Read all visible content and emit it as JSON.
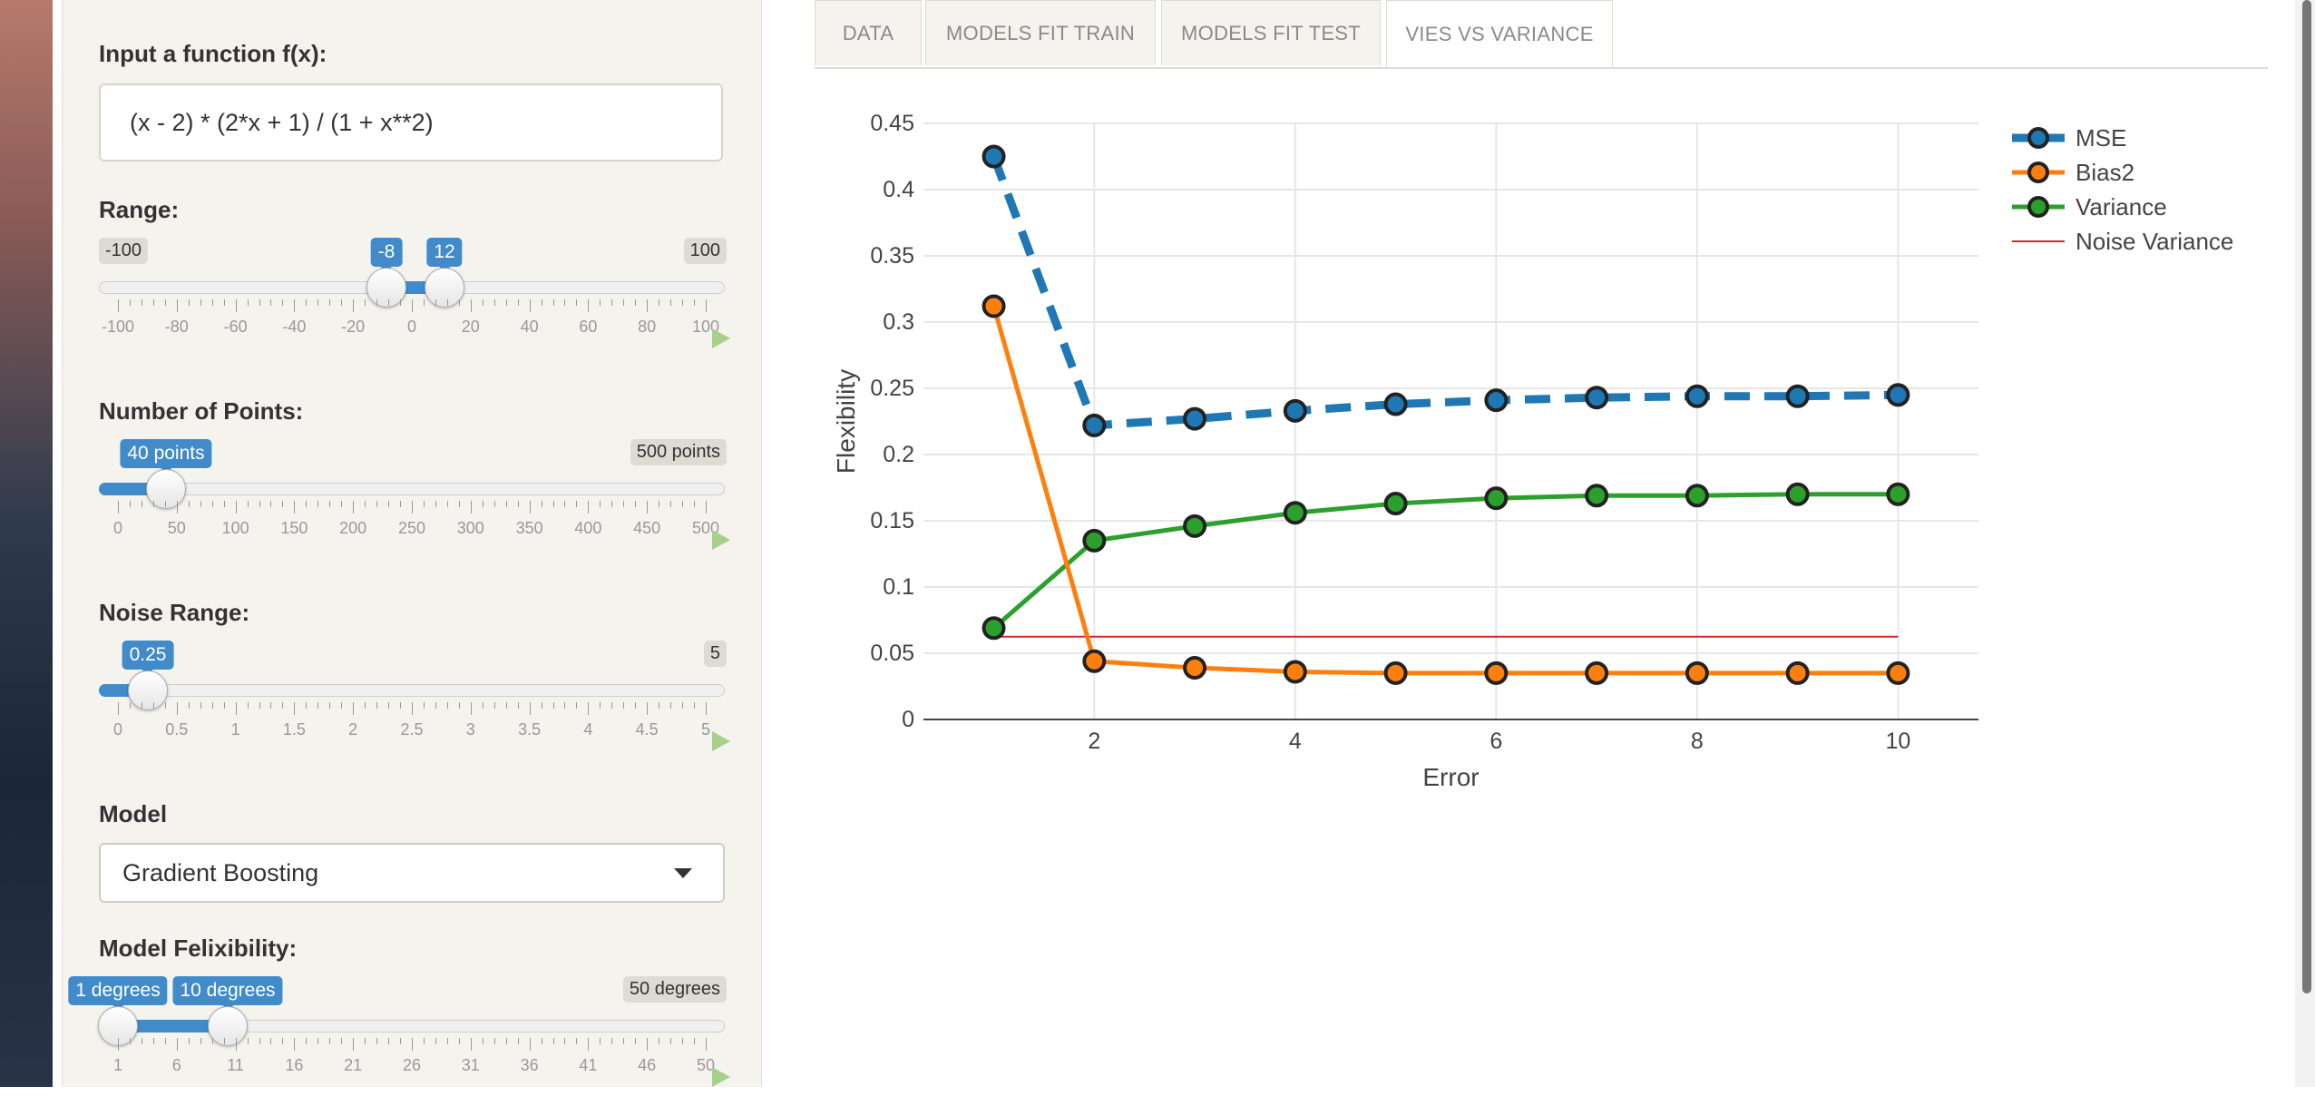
{
  "sidebar": {
    "function": {
      "label": "Input a function f(x):",
      "value": "(x - 2) * (2*x + 1) / (1 + x**2)"
    },
    "range": {
      "label": "Range:",
      "min": "-100",
      "max": "100",
      "low": "-8",
      "high": "12",
      "ticks": [
        "-100",
        "-80",
        "-60",
        "-40",
        "-20",
        "0",
        "20",
        "40",
        "60",
        "80",
        "100"
      ]
    },
    "points": {
      "label": "Number of Points:",
      "value": "40 points",
      "max": "500 points",
      "ticks": [
        "0",
        "50",
        "100",
        "150",
        "200",
        "250",
        "300",
        "350",
        "400",
        "450",
        "500"
      ]
    },
    "noise": {
      "label": "Noise Range:",
      "value": "0.25",
      "max": "5",
      "ticks": [
        "0",
        "0.5",
        "1",
        "1.5",
        "2",
        "2.5",
        "3",
        "3.5",
        "4",
        "4.5",
        "5"
      ]
    },
    "model": {
      "label": "Model",
      "selected": "Gradient Boosting"
    },
    "flex": {
      "label": "Model Felixibility:",
      "low": "1 degrees",
      "high": "10 degrees",
      "max": "50 degrees",
      "ticks": [
        "1",
        "6",
        "11",
        "16",
        "21",
        "26",
        "31",
        "36",
        "41",
        "46",
        "50"
      ]
    },
    "colors": {
      "accent": "#428bca"
    }
  },
  "tabs": [
    {
      "label": "DATA"
    },
    {
      "label": "MODELS FIT TRAIN"
    },
    {
      "label": "MODELS FIT TEST"
    },
    {
      "label": "VIES VS VARIANCE"
    }
  ],
  "chart_data": {
    "type": "line",
    "xlabel": "Error",
    "ylabel": "Flexibility",
    "xlim": [
      0.3,
      10.8
    ],
    "ylim": [
      0,
      0.45
    ],
    "xticks": [
      2,
      4,
      6,
      8,
      10
    ],
    "yticks": [
      0,
      0.05,
      0.1,
      0.15,
      0.2,
      0.25,
      0.3,
      0.35,
      0.4,
      0.45
    ],
    "ytick_labels": [
      "0",
      "0.05",
      "0.1",
      "0.15",
      "0.2",
      "0.25",
      "0.3",
      "0.35",
      "0.4",
      "0.45"
    ],
    "grid": true,
    "legend_position": "top-right",
    "x": [
      1,
      2,
      3,
      4,
      5,
      6,
      7,
      8,
      9,
      10
    ],
    "series": [
      {
        "name": "MSE",
        "color": "#1f77b4",
        "dash": true,
        "values": [
          0.425,
          0.222,
          0.227,
          0.233,
          0.238,
          0.241,
          0.243,
          0.244,
          0.244,
          0.245
        ]
      },
      {
        "name": "Bias2",
        "color": "#ff7f0e",
        "dash": false,
        "values": [
          0.312,
          0.044,
          0.039,
          0.036,
          0.035,
          0.035,
          0.035,
          0.035,
          0.035,
          0.035
        ]
      },
      {
        "name": "Variance",
        "color": "#2ca02c",
        "dash": false,
        "values": [
          0.069,
          0.135,
          0.146,
          0.156,
          0.163,
          0.167,
          0.169,
          0.169,
          0.17,
          0.17
        ]
      },
      {
        "name": "Noise Variance",
        "color": "#d62728",
        "dash": false,
        "markers": false,
        "x": [
          1,
          10
        ],
        "values": [
          0.0625,
          0.0625
        ]
      }
    ]
  }
}
